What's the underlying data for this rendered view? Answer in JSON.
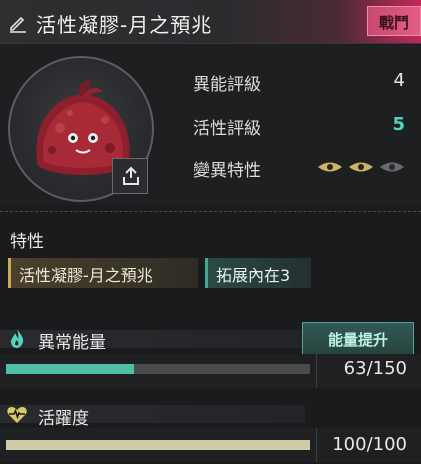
{
  "header": {
    "title": "活性凝膠-月之預兆",
    "mode_badge": "戰鬥",
    "accent_color": "#d8326a"
  },
  "creature": {
    "portrait_alt": "red jelly creature",
    "share_icon": "share-icon"
  },
  "stats": [
    {
      "label": "異能評級",
      "value": "4"
    },
    {
      "label": "活性評級",
      "value": "5",
      "color": "#4fd6bd"
    },
    {
      "label": "變異特性",
      "value": ""
    }
  ],
  "mutation_eyes": {
    "total": 3,
    "active": 2,
    "active_color": "#c9b46a",
    "inactive_color": "#6a6b6e"
  },
  "traits": {
    "heading": "特性",
    "items": [
      {
        "label": "活性凝膠-月之預兆",
        "color": "#c9ab5a"
      },
      {
        "label": "拓展內在3",
        "color": "#3fa796"
      }
    ]
  },
  "energy": {
    "label": "異常能量",
    "button_label": "能量提升",
    "current": 63,
    "max": 150,
    "display": "63/150",
    "bar_color": "#4fbfa8"
  },
  "vitality": {
    "label": "活躍度",
    "current": 100,
    "max": 100,
    "display": "100/100",
    "bar_color": "#cfcba6"
  }
}
